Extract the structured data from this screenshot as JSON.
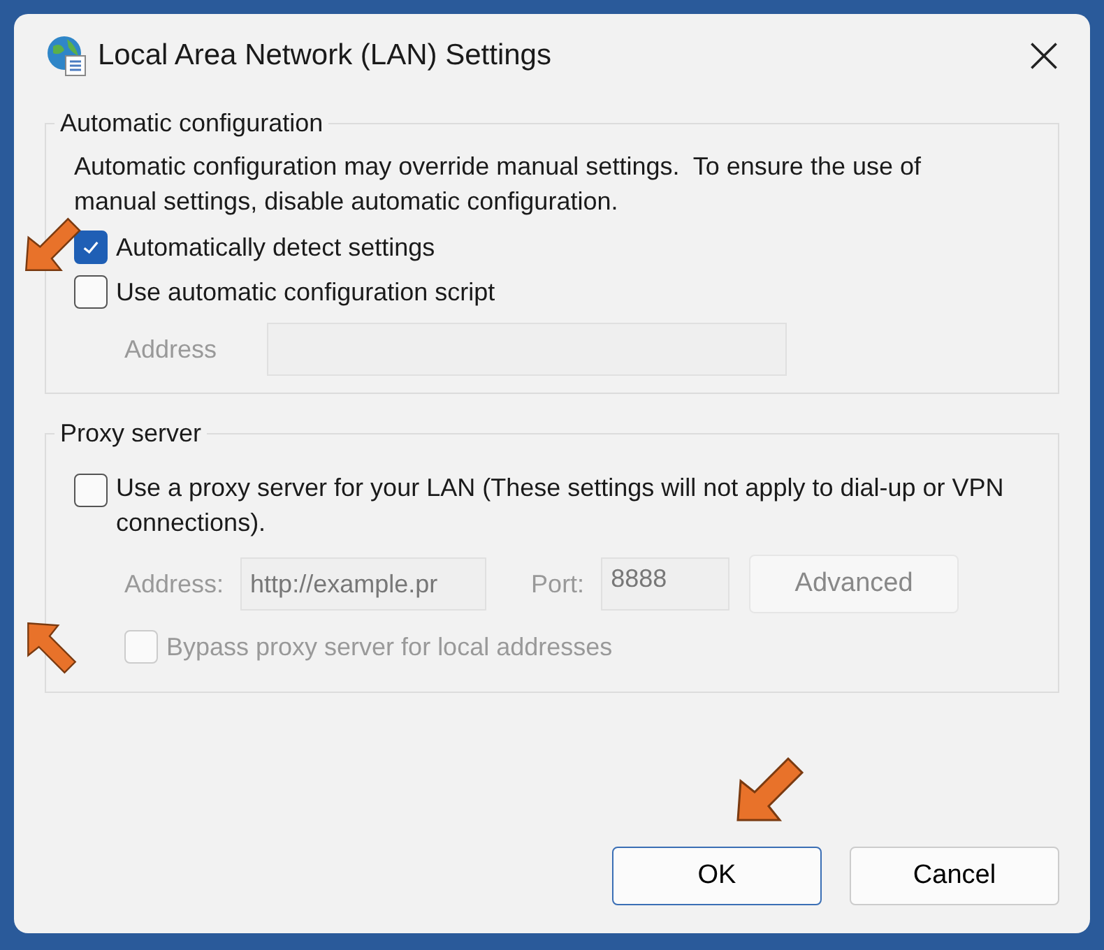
{
  "window": {
    "title": "Local Area Network (LAN) Settings"
  },
  "automatic_configuration": {
    "heading": "Automatic configuration",
    "description": "Automatic configuration may override manual settings.  To ensure the use of manual settings, disable automatic configuration.",
    "options": [
      {
        "label": "Automatically detect settings",
        "checked": true
      },
      {
        "label": "Use automatic configuration script",
        "checked": false
      }
    ],
    "address": {
      "label": "Address",
      "disabled": true
    }
  },
  "proxy_server": {
    "heading": "Proxy server",
    "use_proxy": {
      "label": "Use a proxy server for your LAN (These settings will not apply to dial-up or VPN connections).",
      "checked": false
    },
    "address": {
      "label": "Address:",
      "value": "http://example.pr",
      "disabled": true
    },
    "port": {
      "label": "Port:",
      "value": "8888",
      "disabled": true
    },
    "advanced_button": {
      "label": "Advanced",
      "disabled": true
    },
    "bypass": {
      "label": "Bypass proxy server for local addresses",
      "checked": false,
      "disabled": true
    }
  },
  "buttons": [
    {
      "label": "OK",
      "default": true
    },
    {
      "label": "Cancel",
      "default": false
    }
  ]
}
